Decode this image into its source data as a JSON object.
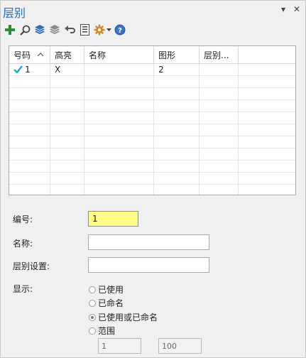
{
  "panel": {
    "title": "层别",
    "pin_glyph": "▾",
    "close_glyph": "✕"
  },
  "toolbar": {
    "items": [
      {
        "name": "add-layer-button",
        "icon": "plus-icon"
      },
      {
        "name": "search-button",
        "icon": "search-icon"
      },
      {
        "name": "layers-button",
        "icon": "layers-blue-icon"
      },
      {
        "name": "layers-gray-button",
        "icon": "layers-gray-icon"
      },
      {
        "name": "undo-button",
        "icon": "undo-icon"
      },
      {
        "name": "list-button",
        "icon": "document-list-icon"
      },
      {
        "name": "settings-button",
        "icon": "gear-icon"
      },
      {
        "name": "help-button",
        "icon": "help-icon"
      }
    ]
  },
  "grid": {
    "columns": [
      "号码",
      "高亮",
      "名称",
      "图形",
      "层别..."
    ],
    "rows": [
      {
        "number": "1",
        "highlight": "X",
        "name": "",
        "entities": "2",
        "group": "",
        "active": true
      }
    ],
    "empty_rows": 11
  },
  "form": {
    "number_label": "编号:",
    "number_value": "1",
    "name_label": "名称:",
    "name_value": "",
    "group_label": "层别设置:",
    "group_value": "",
    "display_label": "显示:",
    "display_options": [
      {
        "label": "已使用",
        "selected": false
      },
      {
        "label": "已命名",
        "selected": false
      },
      {
        "label": "已使用或已命名",
        "selected": true
      },
      {
        "label": "范围",
        "selected": false
      }
    ],
    "range_from": "1",
    "range_to": "100"
  },
  "colors": {
    "title": "#1f6fb5",
    "highlight_input": "#ffff88",
    "check": "#19a7c8"
  }
}
